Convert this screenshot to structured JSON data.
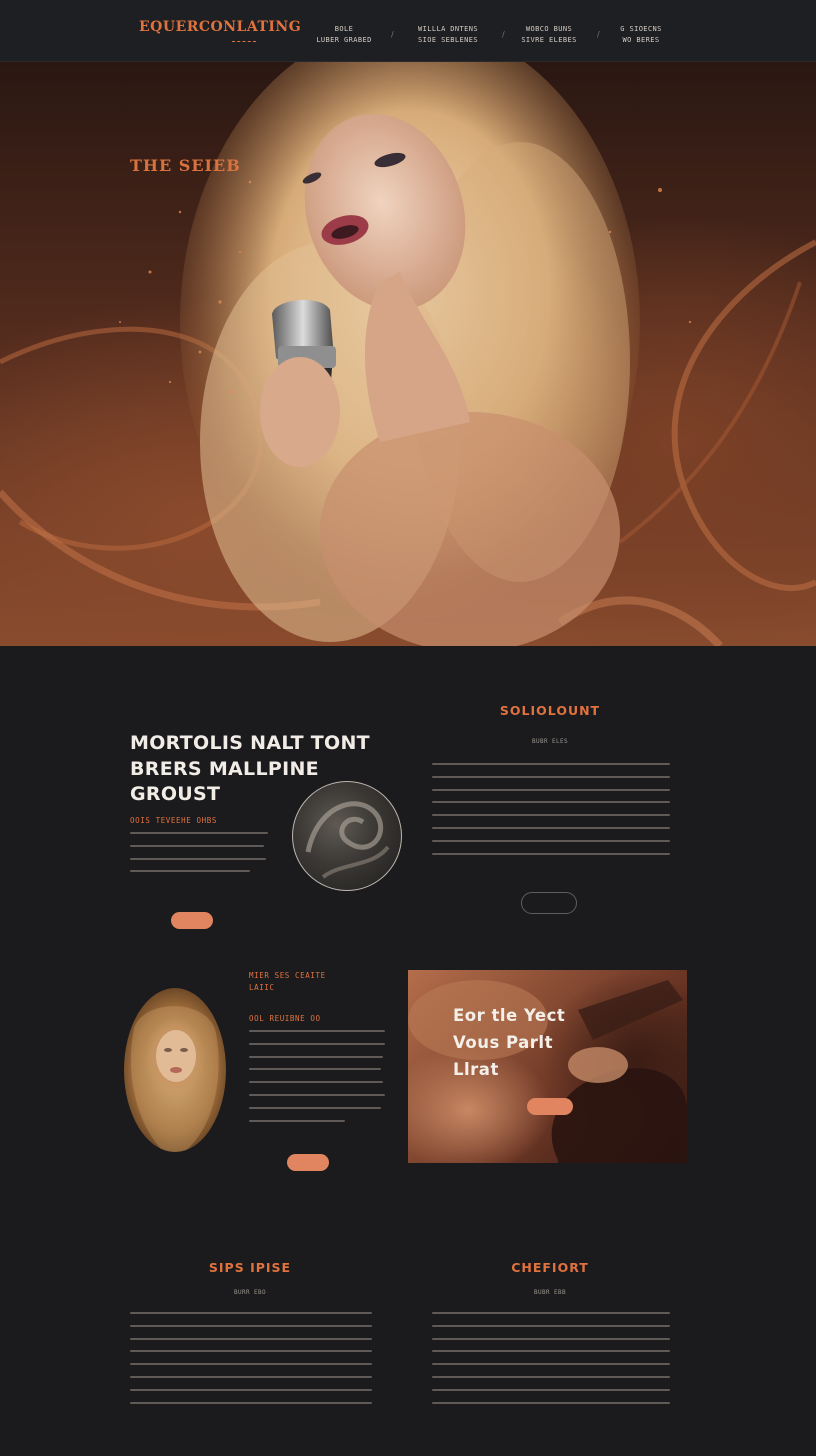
{
  "nav": {
    "logo": "EQUERCONLATING",
    "items": [
      {
        "line1": "BOLE",
        "line2": "LUBER GRABED"
      },
      {
        "line1": "WILLLA DNTENS",
        "line2": "SIOE SEBLENES"
      },
      {
        "line1": "WOBCO BUNS",
        "line2": "SIVRE ELEBES"
      },
      {
        "line1": "G SIOECNS",
        "line2": "WO BERES"
      }
    ]
  },
  "hero": {
    "title": "THE SEIEB"
  },
  "section_intro": {
    "heading_lines": [
      "MORTOLIS NALT TONT",
      "BRERS MALLPINE",
      "GROUST"
    ],
    "subheading": "OOIS TEVEEHE OHBS",
    "right_title": "SOLIOLOUNT",
    "right_subtitle": "BUBR ELES"
  },
  "section_feature": {
    "heading_line1": "MIER SES CEAITE",
    "heading_line2": "LAIIC",
    "subheading": "OOL REUIBNE OO",
    "card_text": [
      "Eor tle Yect",
      "Vous Parlt",
      "Llrat"
    ]
  },
  "section_footer": {
    "left_title": "SIPS IPISE",
    "left_subtitle": "BURR EBO",
    "right_title": "CHEFIORT",
    "right_subtitle": "BUBR EBB"
  },
  "colors": {
    "accent": "#e0723e",
    "background": "#1b1b1e",
    "button": "#e08560"
  },
  "icons": {
    "nav_separator": "slash"
  }
}
